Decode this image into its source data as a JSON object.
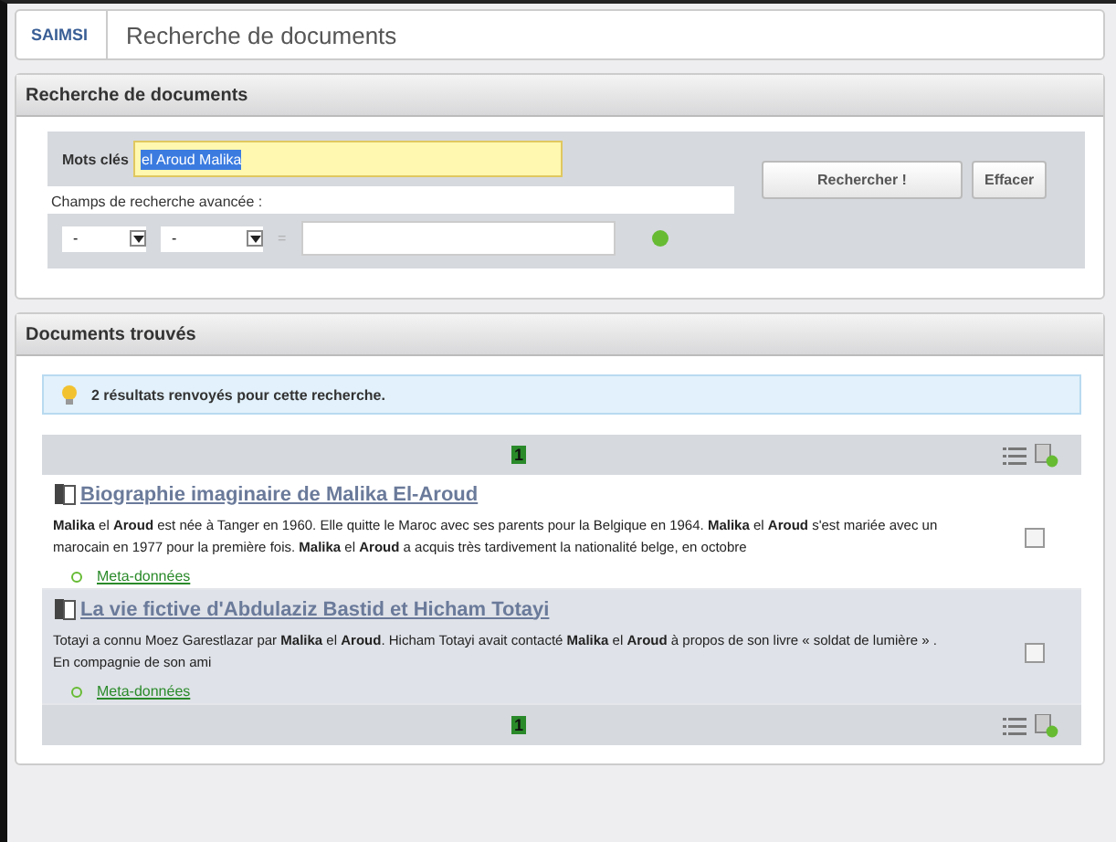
{
  "breadcrumb": {
    "logo": "SAIMSI",
    "title": "Recherche de documents"
  },
  "search_panel": {
    "title": "Recherche de documents",
    "keywords_label": "Mots clés",
    "keywords_value": "el Aroud Malika",
    "keywords_selected": true,
    "advanced_label": "Champs de recherche avancée :",
    "field_select": "-",
    "operator_select": "-",
    "equals": "=",
    "search_button": "Rechercher !",
    "clear_button": "Effacer"
  },
  "results_panel": {
    "title": "Documents trouvés",
    "info": "2 résultats renvoyés pour cette recherche.",
    "pagination_top": [
      {
        "label": "1",
        "selected": true
      }
    ],
    "pagination_bottom": [
      {
        "label": "1",
        "selected": true
      }
    ],
    "results": [
      {
        "title": "Biographie imaginaire de Malika El-Aroud",
        "snippet": "**Malika** el **Aroud** est née à Tanger en 1960. Elle quitte le Maroc avec ses parents pour la Belgique en 1964. **Malika** el **Aroud** s'est mariée avec un marocain en 1977 pour la première fois. **Malika** el **Aroud** a acquis très tardivement la nationalité belge, en octobre",
        "link": "Meta-données",
        "checked": false,
        "highlighted": false
      },
      {
        "title": "La vie fictive d'Abdulaziz Bastid et Hicham Totayi",
        "snippet": "Totayi a connu Moez Garestlazar par **Malika** el **Aroud**. Hicham Totayi avait contacté **Malika** el **Aroud** à propos de son livre « soldat de lumière » . En compagnie de son ami",
        "link": "Meta-données",
        "checked": false,
        "highlighted": true
      }
    ]
  }
}
